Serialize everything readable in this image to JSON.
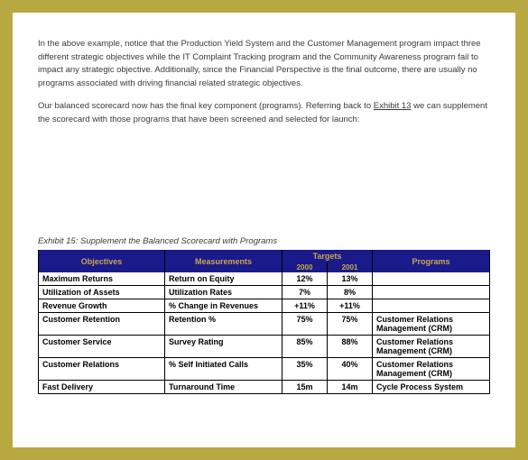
{
  "paragraphs": {
    "p1": "In the above example, notice that the Production Yield System and the Customer Management program impact three different strategic objectives while the IT Complaint Tracking program and the Community Awareness program fail to impact any strategic objective. Additionally, since the Financial Perspective is the final outcome, there are usually no programs associated with driving financial related strategic objectives.",
    "p2_before": "Our balanced scorecard now has the final key component (programs). Referring back to ",
    "p2_link": "Exhibit 13",
    "p2_after": " we can supplement the scorecard with those programs that have been screened and selected for launch:"
  },
  "exhibit_title": "Exhibit 15: Supplement the Balanced Scorecard with Programs",
  "chart_data": {
    "type": "table",
    "headers": {
      "objectives": "Objectives",
      "measurements": "Measurements",
      "targets": "Targets",
      "programs": "Programs",
      "y1": "2000",
      "y2": "2001"
    },
    "rows": [
      {
        "objective": "Maximum Returns",
        "measurement": "Return on Equity",
        "t1": "12%",
        "t2": "13%",
        "program": ""
      },
      {
        "objective": "Utilization of Assets",
        "measurement": "Utilization Rates",
        "t1": "7%",
        "t2": "8%",
        "program": ""
      },
      {
        "objective": "Revenue Growth",
        "measurement": "% Change in Revenues",
        "t1": "+11%",
        "t2": "+11%",
        "program": ""
      },
      {
        "objective": "Customer Retention",
        "measurement": "Retention %",
        "t1": "75%",
        "t2": "75%",
        "program": "Customer Relations Management (CRM)"
      },
      {
        "objective": "Customer Service",
        "measurement": "Survey Rating",
        "t1": "85%",
        "t2": "88%",
        "program": "Customer Relations Management (CRM)"
      },
      {
        "objective": "Customer Relations",
        "measurement": "% Self Initiated Calls",
        "t1": "35%",
        "t2": "40%",
        "program": "Customer Relations Management (CRM)"
      },
      {
        "objective": "Fast Delivery",
        "measurement": "Turnaround Time",
        "t1": "15m",
        "t2": "14m",
        "program": "Cycle Process System"
      }
    ]
  }
}
